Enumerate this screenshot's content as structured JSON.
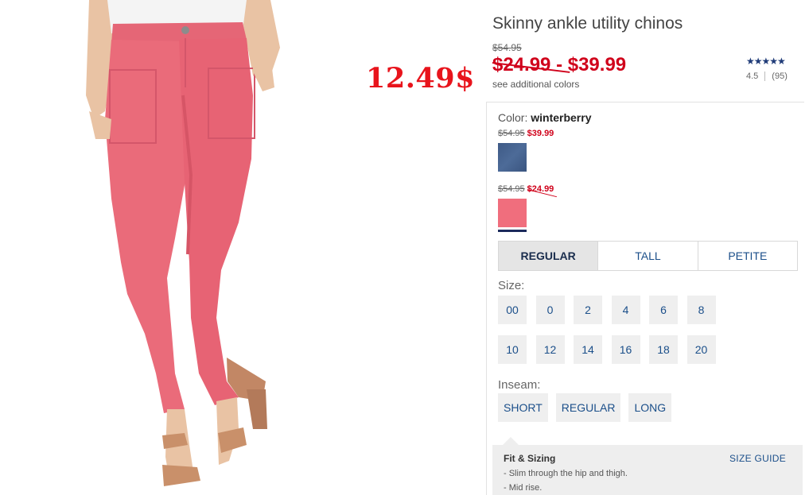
{
  "product": {
    "title": "Skinny ankle utility chinos",
    "original_price": "$54.95",
    "price_low": "$24.99",
    "price_sep": " - ",
    "price_high": "$39.99",
    "see_colors": "see additional colors",
    "rating_stars": "★★★★★",
    "rating_value": "4.5",
    "review_count": "(95)"
  },
  "promo": {
    "sale_price": "12.49$",
    "color": "#e8141c"
  },
  "color_select": {
    "label": "Color: ",
    "selected": "winterberry",
    "options": [
      {
        "old_price": "$54.95",
        "new_price": "$39.99",
        "swatch": "#44618e"
      },
      {
        "old_price": "$54.95",
        "new_price": "$24.99",
        "swatch": "#f06e7d"
      }
    ]
  },
  "fit_tabs": [
    "REGULAR",
    "TALL",
    "PETITE"
  ],
  "size": {
    "label": "Size:",
    "options": [
      "00",
      "0",
      "2",
      "4",
      "6",
      "8",
      "10",
      "12",
      "14",
      "16",
      "18",
      "20"
    ]
  },
  "inseam": {
    "label": "Inseam:",
    "options": [
      "SHORT",
      "REGULAR",
      "LONG"
    ]
  },
  "fit_sizing": {
    "title": "Fit & Sizing",
    "size_guide": "SIZE GUIDE",
    "lines": [
      "- Slim through the hip and thigh.",
      "- Mid rise."
    ]
  },
  "colors": {
    "sale_red": "#d0021b",
    "link_blue": "#1b4f8a",
    "pant_pink": "#ea6b7a"
  }
}
